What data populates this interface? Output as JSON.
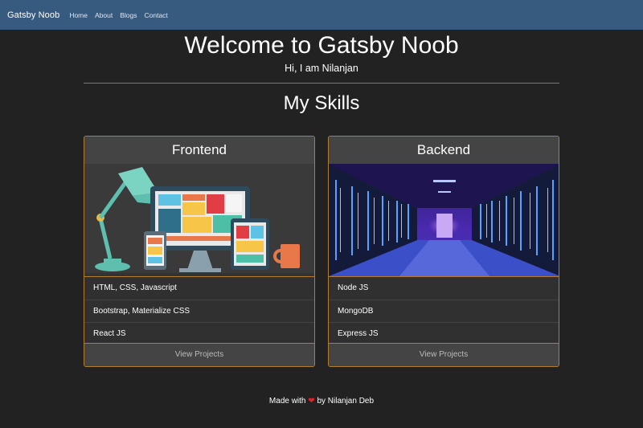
{
  "navbar": {
    "brand": "Gatsby Noob",
    "links": [
      "Home",
      "About",
      "Blogs",
      "Contact"
    ]
  },
  "hero": {
    "title": "Welcome to Gatsby Noob",
    "subtitle": "Hi, I am Nilanjan"
  },
  "skills": {
    "title": "My Skills",
    "cards": [
      {
        "title": "Frontend",
        "items": [
          "HTML, CSS, Javascript",
          "Bootstrap, Materialize CSS",
          "React JS"
        ],
        "button": "View Projects"
      },
      {
        "title": "Backend",
        "items": [
          "Node JS",
          "MongoDB",
          "Express JS"
        ],
        "button": "View Projects"
      }
    ]
  },
  "footer": {
    "prefix": "Made with",
    "heart": "❤",
    "suffix": "by Nilanjan Deb"
  },
  "colors": {
    "navbar": "#375a7f",
    "background": "#222222",
    "card_border": "#b27d2c"
  }
}
